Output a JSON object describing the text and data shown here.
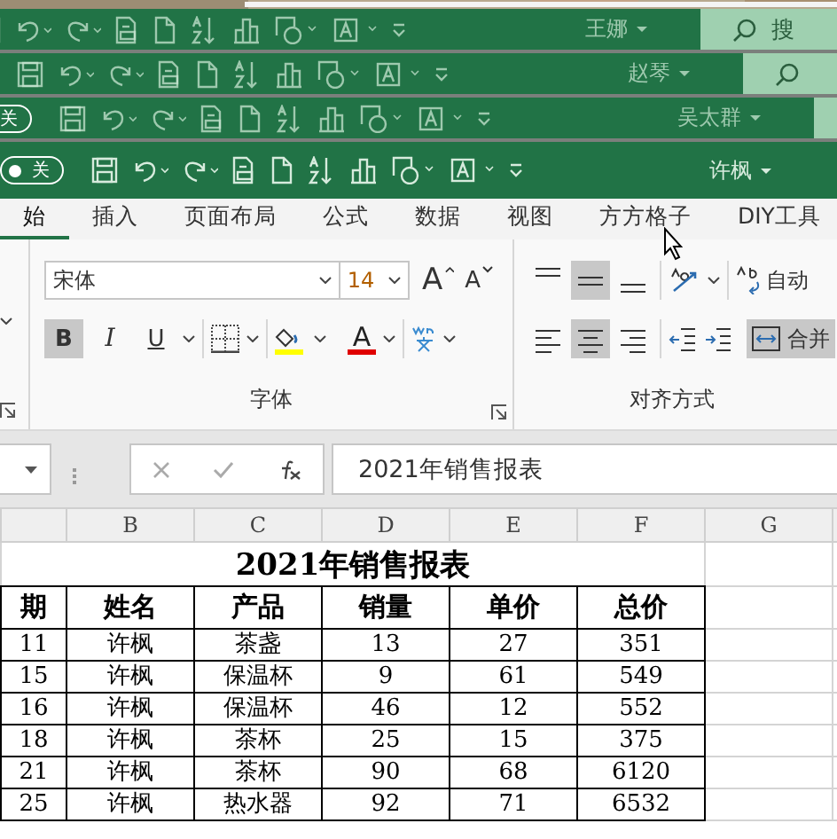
{
  "windows": [
    {
      "user": "王娜",
      "search_placeholder": "搜"
    },
    {
      "user": "赵琴",
      "has_search": true
    },
    {
      "user": "吴太群",
      "toggle": {
        "label": "关",
        "on": false
      },
      "has_search": true
    },
    {
      "user": "许枫",
      "toggle": {
        "label": "关",
        "on": false
      }
    }
  ],
  "tabs": [
    {
      "label": "始",
      "selected": true
    },
    {
      "label": "插入",
      "selected": false
    },
    {
      "label": "页面布局",
      "selected": false
    },
    {
      "label": "公式",
      "selected": false
    },
    {
      "label": "数据",
      "selected": false
    },
    {
      "label": "视图",
      "selected": false
    },
    {
      "label": "方方格子",
      "selected": false
    },
    {
      "label": "DIY工具",
      "selected": false
    }
  ],
  "font_group": {
    "label": "字体",
    "font_name": "宋体",
    "font_size": "14",
    "grow": "A",
    "shrink": "A",
    "bold": {
      "label": "B",
      "selected": true
    },
    "italic": {
      "label": "I",
      "selected": false
    },
    "underline": {
      "label": "U",
      "selected": false
    },
    "font_color": "A"
  },
  "align_group": {
    "label": "对齐方式",
    "vertical": [
      {
        "selected": false
      },
      {
        "selected": true
      },
      {
        "selected": false
      }
    ],
    "horizontal": [
      {
        "selected": false
      },
      {
        "selected": true
      },
      {
        "selected": false
      }
    ],
    "wrap_text": "自动",
    "merge": {
      "label": "合并",
      "selected": true
    }
  },
  "formula_bar": {
    "value": "2021年销售报表"
  },
  "sheet": {
    "columns": [
      "",
      "B",
      "C",
      "D",
      "E",
      "F",
      "G"
    ],
    "title": "2021年销售报表",
    "header": [
      "期",
      "姓名",
      "产品",
      "销量",
      "单价",
      "总价"
    ],
    "rows": [
      [
        "11",
        "许枫",
        "茶盏",
        "13",
        "27",
        "351"
      ],
      [
        "15",
        "许枫",
        "保温杯",
        "9",
        "61",
        "549"
      ],
      [
        "16",
        "许枫",
        "保温杯",
        "46",
        "12",
        "552"
      ],
      [
        "18",
        "许枫",
        "茶杯",
        "25",
        "15",
        "375"
      ],
      [
        "21",
        "许枫",
        "茶杯",
        "90",
        "68",
        "6120"
      ],
      [
        "25",
        "许枫",
        "热水器",
        "92",
        "71",
        "6532"
      ]
    ]
  }
}
